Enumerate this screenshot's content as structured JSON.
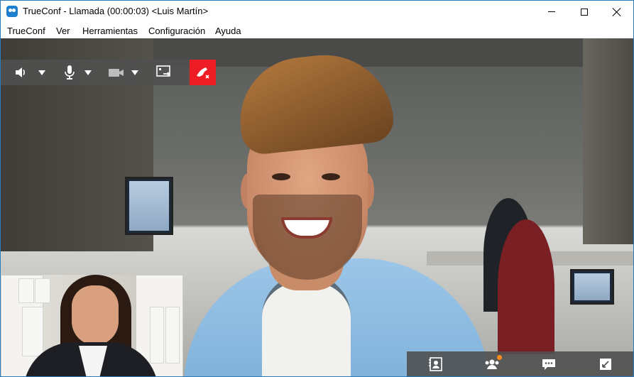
{
  "window": {
    "title": "TrueConf - Llamada (00:00:03) <Luis Martín>",
    "icon": "trueconf-app-icon",
    "controls": [
      "minimize-icon",
      "maximize-icon",
      "close-icon"
    ]
  },
  "menu": {
    "items": [
      {
        "label": "TrueConf"
      },
      {
        "label": "Ver"
      },
      {
        "label": "Herramientas"
      },
      {
        "label": "Configuración"
      },
      {
        "label": "Ayuda"
      }
    ]
  },
  "call_toolbar": {
    "buttons": [
      {
        "icon": "speaker-icon",
        "has_dropdown": true
      },
      {
        "icon": "microphone-icon",
        "has_dropdown": true
      },
      {
        "icon": "camera-icon",
        "has_dropdown": true,
        "state": "disabled"
      },
      {
        "icon": "share-screen-icon",
        "has_dropdown": false
      },
      {
        "icon": "hangup-icon",
        "has_dropdown": false
      }
    ],
    "hangup_color": "#ee1c24"
  },
  "video": {
    "remote_participant": "Luis Martín",
    "self_view": true
  },
  "bottom_toolbar": {
    "buttons": [
      {
        "icon": "contacts-icon"
      },
      {
        "icon": "participants-icon",
        "notification": true
      },
      {
        "icon": "chat-icon"
      },
      {
        "icon": "fullscreen-toggle-icon"
      }
    ],
    "notification_color": "#ff8c1a"
  }
}
